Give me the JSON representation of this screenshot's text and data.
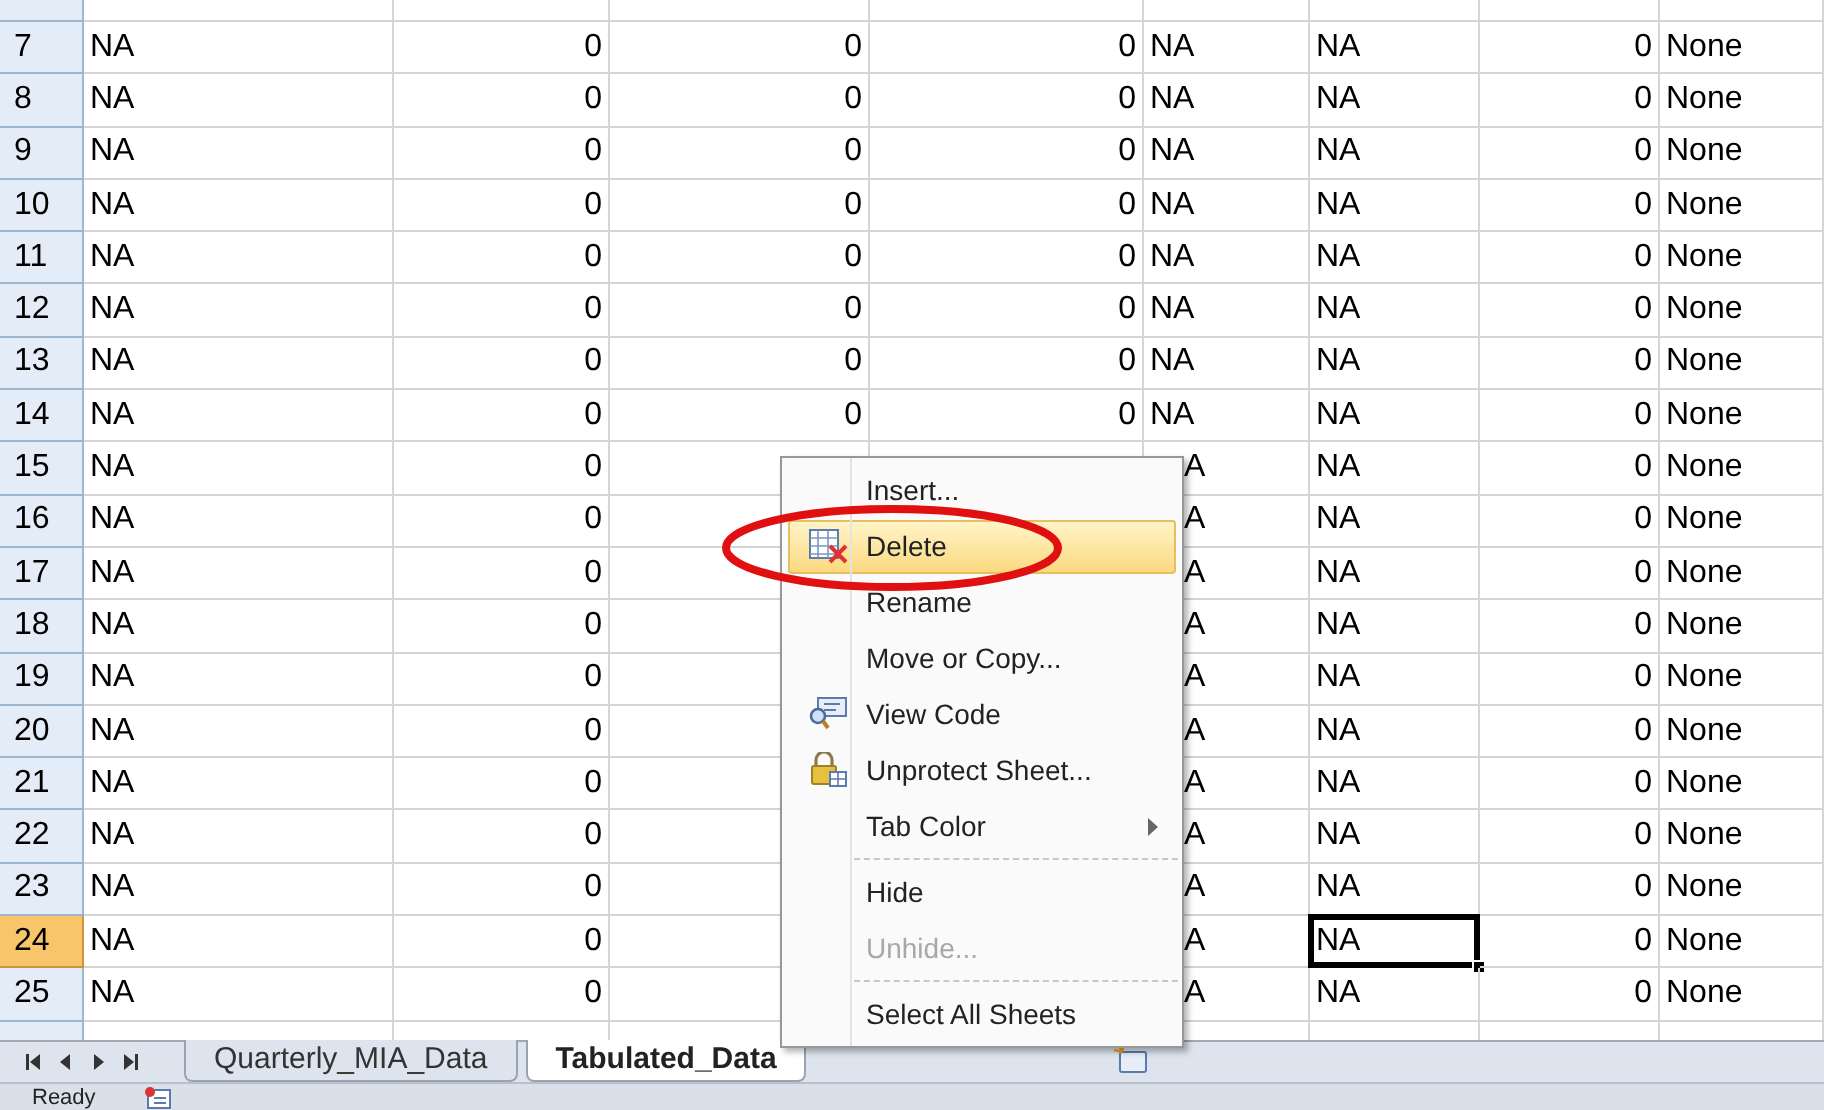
{
  "rows": [
    {
      "header": "7",
      "selected": false,
      "cells": [
        {
          "text": "NA",
          "selected": false
        },
        {
          "text": "0",
          "selected": false
        },
        {
          "text": "0",
          "selected": false
        },
        {
          "text": "0",
          "selected": false
        },
        {
          "text": "NA",
          "selected": false
        },
        {
          "text": "NA",
          "selected": false
        },
        {
          "text": "0",
          "selected": false
        },
        {
          "text": "None",
          "selected": false
        }
      ]
    },
    {
      "header": "8",
      "selected": false,
      "cells": [
        {
          "text": "NA",
          "selected": false
        },
        {
          "text": "0",
          "selected": false
        },
        {
          "text": "0",
          "selected": false
        },
        {
          "text": "0",
          "selected": false
        },
        {
          "text": "NA",
          "selected": false
        },
        {
          "text": "NA",
          "selected": false
        },
        {
          "text": "0",
          "selected": false
        },
        {
          "text": "None",
          "selected": false
        }
      ]
    },
    {
      "header": "9",
      "selected": false,
      "cells": [
        {
          "text": "NA",
          "selected": false
        },
        {
          "text": "0",
          "selected": false
        },
        {
          "text": "0",
          "selected": false
        },
        {
          "text": "0",
          "selected": false
        },
        {
          "text": "NA",
          "selected": false
        },
        {
          "text": "NA",
          "selected": false
        },
        {
          "text": "0",
          "selected": false
        },
        {
          "text": "None",
          "selected": false
        }
      ]
    },
    {
      "header": "10",
      "selected": false,
      "cells": [
        {
          "text": "NA",
          "selected": false
        },
        {
          "text": "0",
          "selected": false
        },
        {
          "text": "0",
          "selected": false
        },
        {
          "text": "0",
          "selected": false
        },
        {
          "text": "NA",
          "selected": false
        },
        {
          "text": "NA",
          "selected": false
        },
        {
          "text": "0",
          "selected": false
        },
        {
          "text": "None",
          "selected": false
        }
      ]
    },
    {
      "header": "11",
      "selected": false,
      "cells": [
        {
          "text": "NA",
          "selected": false
        },
        {
          "text": "0",
          "selected": false
        },
        {
          "text": "0",
          "selected": false
        },
        {
          "text": "0",
          "selected": false
        },
        {
          "text": "NA",
          "selected": false
        },
        {
          "text": "NA",
          "selected": false
        },
        {
          "text": "0",
          "selected": false
        },
        {
          "text": "None",
          "selected": false
        }
      ]
    },
    {
      "header": "12",
      "selected": false,
      "cells": [
        {
          "text": "NA",
          "selected": false
        },
        {
          "text": "0",
          "selected": false
        },
        {
          "text": "0",
          "selected": false
        },
        {
          "text": "0",
          "selected": false
        },
        {
          "text": "NA",
          "selected": false
        },
        {
          "text": "NA",
          "selected": false
        },
        {
          "text": "0",
          "selected": false
        },
        {
          "text": "None",
          "selected": false
        }
      ]
    },
    {
      "header": "13",
      "selected": false,
      "cells": [
        {
          "text": "NA",
          "selected": false
        },
        {
          "text": "0",
          "selected": false
        },
        {
          "text": "0",
          "selected": false
        },
        {
          "text": "0",
          "selected": false
        },
        {
          "text": "NA",
          "selected": false
        },
        {
          "text": "NA",
          "selected": false
        },
        {
          "text": "0",
          "selected": false
        },
        {
          "text": "None",
          "selected": false
        }
      ]
    },
    {
      "header": "14",
      "selected": false,
      "cells": [
        {
          "text": "NA",
          "selected": false
        },
        {
          "text": "0",
          "selected": false
        },
        {
          "text": "0",
          "selected": false
        },
        {
          "text": "0",
          "selected": false
        },
        {
          "text": "NA",
          "selected": false
        },
        {
          "text": "NA",
          "selected": false
        },
        {
          "text": "0",
          "selected": false
        },
        {
          "text": "None",
          "selected": false
        }
      ]
    },
    {
      "header": "15",
      "selected": false,
      "cells": [
        {
          "text": "NA",
          "selected": false
        },
        {
          "text": "0",
          "selected": false
        },
        null,
        null,
        {
          "text": "A",
          "selected": false
        },
        {
          "text": "NA",
          "selected": false
        },
        {
          "text": "0",
          "selected": false
        },
        {
          "text": "None",
          "selected": false
        }
      ]
    },
    {
      "header": "16",
      "selected": false,
      "cells": [
        {
          "text": "NA",
          "selected": false
        },
        {
          "text": "0",
          "selected": false
        },
        null,
        null,
        {
          "text": "A",
          "selected": false
        },
        {
          "text": "NA",
          "selected": false
        },
        {
          "text": "0",
          "selected": false
        },
        {
          "text": "None",
          "selected": false
        }
      ]
    },
    {
      "header": "17",
      "selected": false,
      "cells": [
        {
          "text": "NA",
          "selected": false
        },
        {
          "text": "0",
          "selected": false
        },
        null,
        null,
        {
          "text": "A",
          "selected": false
        },
        {
          "text": "NA",
          "selected": false
        },
        {
          "text": "0",
          "selected": false
        },
        {
          "text": "None",
          "selected": false
        }
      ]
    },
    {
      "header": "18",
      "selected": false,
      "cells": [
        {
          "text": "NA",
          "selected": false
        },
        {
          "text": "0",
          "selected": false
        },
        null,
        null,
        {
          "text": "A",
          "selected": false
        },
        {
          "text": "NA",
          "selected": false
        },
        {
          "text": "0",
          "selected": false
        },
        {
          "text": "None",
          "selected": false
        }
      ]
    },
    {
      "header": "19",
      "selected": false,
      "cells": [
        {
          "text": "NA",
          "selected": false
        },
        {
          "text": "0",
          "selected": false
        },
        null,
        null,
        {
          "text": "A",
          "selected": false
        },
        {
          "text": "NA",
          "selected": false
        },
        {
          "text": "0",
          "selected": false
        },
        {
          "text": "None",
          "selected": false
        }
      ]
    },
    {
      "header": "20",
      "selected": false,
      "cells": [
        {
          "text": "NA",
          "selected": false
        },
        {
          "text": "0",
          "selected": false
        },
        null,
        null,
        {
          "text": "A",
          "selected": false
        },
        {
          "text": "NA",
          "selected": false
        },
        {
          "text": "0",
          "selected": false
        },
        {
          "text": "None",
          "selected": false
        }
      ]
    },
    {
      "header": "21",
      "selected": false,
      "cells": [
        {
          "text": "NA",
          "selected": false
        },
        {
          "text": "0",
          "selected": false
        },
        null,
        null,
        {
          "text": "A",
          "selected": false
        },
        {
          "text": "NA",
          "selected": false
        },
        {
          "text": "0",
          "selected": false
        },
        {
          "text": "None",
          "selected": false
        }
      ]
    },
    {
      "header": "22",
      "selected": false,
      "cells": [
        {
          "text": "NA",
          "selected": false
        },
        {
          "text": "0",
          "selected": false
        },
        null,
        null,
        {
          "text": "A",
          "selected": false
        },
        {
          "text": "NA",
          "selected": false
        },
        {
          "text": "0",
          "selected": false
        },
        {
          "text": "None",
          "selected": false
        }
      ]
    },
    {
      "header": "23",
      "selected": false,
      "cells": [
        {
          "text": "NA",
          "selected": false
        },
        {
          "text": "0",
          "selected": false
        },
        null,
        null,
        {
          "text": "A",
          "selected": false
        },
        {
          "text": "NA",
          "selected": false
        },
        {
          "text": "0",
          "selected": false
        },
        {
          "text": "None",
          "selected": false
        }
      ]
    },
    {
      "header": "24",
      "selected": true,
      "cells": [
        {
          "text": "NA",
          "selected": false
        },
        {
          "text": "0",
          "selected": false
        },
        null,
        null,
        {
          "text": "A",
          "selected": false
        },
        {
          "text": "NA",
          "selected": true
        },
        {
          "text": "0",
          "selected": false
        },
        {
          "text": "None",
          "selected": false
        }
      ]
    },
    {
      "header": "25",
      "selected": false,
      "cells": [
        {
          "text": "NA",
          "selected": false
        },
        {
          "text": "0",
          "selected": false
        },
        null,
        null,
        {
          "text": "A",
          "selected": false
        },
        {
          "text": "NA",
          "selected": false
        },
        {
          "text": "0",
          "selected": false
        },
        {
          "text": "None",
          "selected": false
        }
      ]
    }
  ],
  "context_menu": {
    "items": [
      {
        "kind": "item",
        "label": "Insert...",
        "disabled": false,
        "selected": false
      },
      {
        "kind": "item",
        "label": "Delete",
        "disabled": false,
        "selected": true
      },
      {
        "kind": "item",
        "label": "Rename",
        "disabled": false,
        "selected": false
      },
      {
        "kind": "item",
        "label": "Move or Copy...",
        "disabled": false,
        "selected": false
      },
      {
        "kind": "item",
        "label": "View Code",
        "disabled": false,
        "selected": false
      },
      {
        "kind": "item",
        "label": "Unprotect Sheet...",
        "disabled": false,
        "selected": false
      },
      {
        "kind": "submenu",
        "label": "Tab Color",
        "disabled": false,
        "selected": false
      },
      {
        "kind": "separator"
      },
      {
        "kind": "item",
        "label": "Hide",
        "disabled": false,
        "selected": false
      },
      {
        "kind": "item",
        "label": "Unhide...",
        "disabled": true,
        "selected": false
      },
      {
        "kind": "separator"
      },
      {
        "kind": "item",
        "label": "Select All Sheets",
        "disabled": false,
        "selected": false
      }
    ]
  },
  "sheet_tabs": [
    {
      "label": "Quarterly_MIA_Data",
      "selected": false
    },
    {
      "label": "Tabulated_Data",
      "selected": true
    }
  ],
  "status_bar": {
    "text": "Ready"
  }
}
